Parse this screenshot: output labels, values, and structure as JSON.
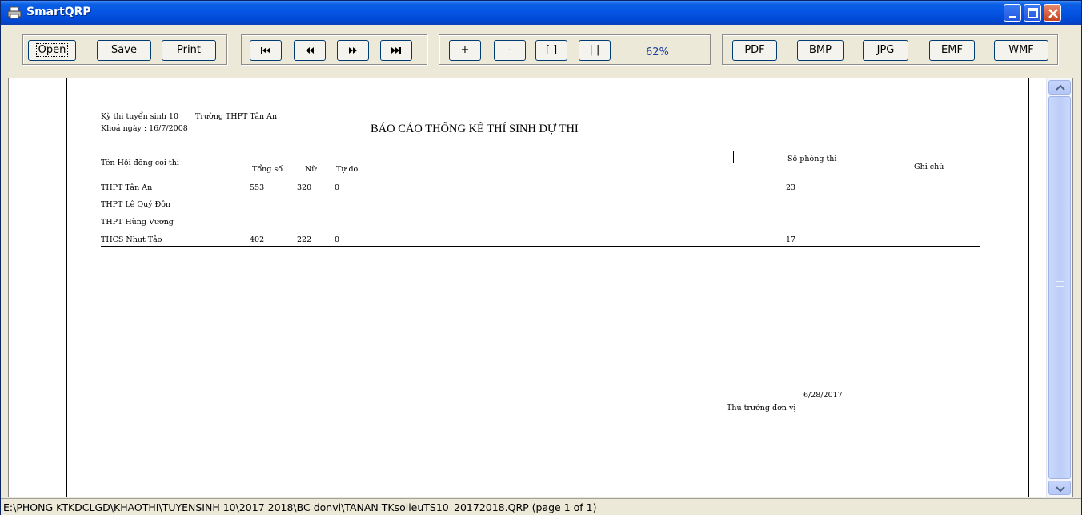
{
  "window": {
    "title": "SmartQRP"
  },
  "toolbar": {
    "open": "Open",
    "save": "Save",
    "print": "Print",
    "first": "first-page",
    "prev": "previous-page",
    "next": "next-page",
    "last": "last-page",
    "zoom_in": "+",
    "zoom_out": "-",
    "fit_page": "[ ]",
    "fit_width": "| |",
    "zoom_level": "62%",
    "pdf": "PDF",
    "bmp": "BMP",
    "jpg": "JPG",
    "emf": "EMF",
    "wmf": "WMF"
  },
  "report": {
    "header_line1": "Kỳ thi tuyển sinh 10",
    "school": "Trường THPT Tân An",
    "header_line2": "Khoá ngày : 16/7/2008",
    "title": "BÁO CÁO THỐNG KÊ THÍ SINH DỰ THI",
    "columns": {
      "council": "Tên Hội đồng coi thi",
      "total": "Tổng số",
      "female": "Nữ",
      "free": "Tự do",
      "rooms": "Số phòng thi",
      "note": "Ghi chú"
    },
    "rows": [
      {
        "council": "THPT Tân An",
        "total": "553",
        "female": "320",
        "free": "0",
        "rooms": "23"
      },
      {
        "council": "THPT Lê Quý Đôn",
        "total": "",
        "female": "",
        "free": "",
        "rooms": ""
      },
      {
        "council": "THPT Hùng Vương",
        "total": "",
        "female": "",
        "free": "",
        "rooms": ""
      },
      {
        "council": "THCS Nhựt Tảo",
        "total": "402",
        "female": "222",
        "free": "0",
        "rooms": "17"
      }
    ],
    "date": "6/28/2017",
    "signature": "Thủ trưởng đơn vị"
  },
  "status": {
    "path": "E:\\PHONG KTKDCLGD\\KHAOTHI\\TUYENSINH 10\\2017 2018\\BC donvi\\TANAN TKsolieuTS10_20172018.QRP (page 1 of 1)"
  }
}
